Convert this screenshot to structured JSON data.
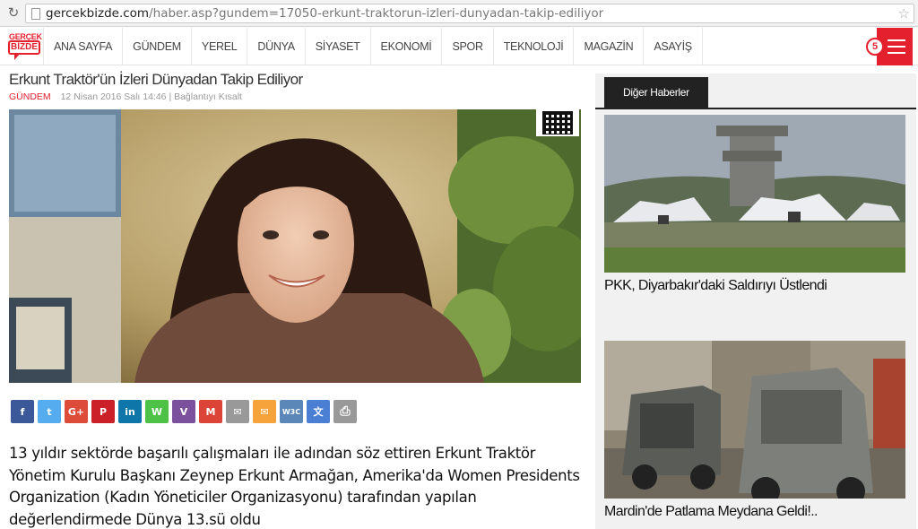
{
  "browser": {
    "url_domain": "gercekbizde.com",
    "url_path": "/haber.asp?gundem=17050-erkunt-traktorun-izleri-dunyadan-takip-ediliyor"
  },
  "logo": {
    "line1": "GERÇEK",
    "line2": "BİZDE"
  },
  "nav": {
    "items": [
      "ANA SAYFA",
      "GÜNDEM",
      "YEREL",
      "DÜNYA",
      "SİYASET",
      "EKONOMİ",
      "SPOR",
      "TEKNOLOJİ",
      "MAGAZİN",
      "ASAYİŞ"
    ],
    "badge_count": "5"
  },
  "article": {
    "title": "Erkunt Traktör'ün İzleri Dünyadan Takip Ediliyor",
    "category": "GÜNDEM",
    "date": "12 Nisan 2016 Salı 14:46",
    "separator": "|",
    "short_link": "Bağlantıyı Kısalt",
    "summary": "13 yıldır sektörde başarılı çalışmaları ile adından söz ettiren Erkunt Traktör Yönetim Kurulu Başkanı Zeynep Erkunt Armağan, Amerika'da Women Presidents Organization (Kadın Yöneticiler Organizasyonu) tarafından yapılan değerlendirmede Dünya 13.sü oldu"
  },
  "share": [
    {
      "icon": "facebook-icon",
      "glyph": "f",
      "color": "#3b5998"
    },
    {
      "icon": "twitter-icon",
      "glyph": "t",
      "color": "#55acee"
    },
    {
      "icon": "google-plus-icon",
      "glyph": "G+",
      "color": "#dd4b39"
    },
    {
      "icon": "pinterest-icon",
      "glyph": "P",
      "color": "#cb2027"
    },
    {
      "icon": "linkedin-icon",
      "glyph": "in",
      "color": "#0e76a8"
    },
    {
      "icon": "whatsapp-icon",
      "glyph": "W",
      "color": "#4dc247"
    },
    {
      "icon": "viber-icon",
      "glyph": "V",
      "color": "#7b519d"
    },
    {
      "icon": "gmail-icon",
      "glyph": "M",
      "color": "#db4437"
    },
    {
      "icon": "email-icon",
      "glyph": "✉",
      "color": "#999999"
    },
    {
      "icon": "mail-orange-icon",
      "glyph": "✉",
      "color": "#f7a33b"
    },
    {
      "icon": "w3c-icon",
      "glyph": "W3C",
      "color": "#5a86b8"
    },
    {
      "icon": "translate-icon",
      "glyph": "文",
      "color": "#4a7fd4"
    },
    {
      "icon": "print-icon",
      "glyph": "⎙",
      "color": "#999999"
    }
  ],
  "sidebar": {
    "tab_label": "Diğer Haberler",
    "cards": [
      {
        "title": "PKK, Diyarbakır'daki Saldırıyı Üstlendi"
      },
      {
        "title": "Mardin'de Patlama Meydana Geldi!.."
      }
    ]
  },
  "colors": {
    "brand_red": "#e4202e",
    "tab_dark": "#222222",
    "sidebar_bg": "#f1f1f1"
  }
}
